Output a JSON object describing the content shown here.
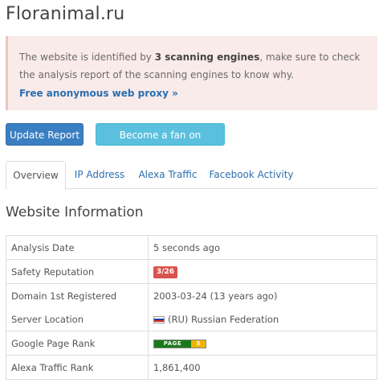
{
  "site_title": "Floranimal.ru",
  "alert": {
    "text_before": "The website is identified by ",
    "text_bold": "3 scanning engines",
    "text_after": ", make sure to check the analysis report of the scanning engines to know why.",
    "proxy_link": "Free anonymous web proxy »"
  },
  "buttons": {
    "update_report": "Update Report",
    "facebook_fan": "Become a fan on Facebook"
  },
  "tabs": [
    {
      "label": "Overview",
      "active": true
    },
    {
      "label": "IP Address",
      "active": false
    },
    {
      "label": "Alexa Traffic",
      "active": false
    },
    {
      "label": "Facebook Activity",
      "active": false
    }
  ],
  "section_title": "Website Information",
  "info": {
    "analysis_date_label": "Analysis Date",
    "analysis_date_value": "5 seconds ago",
    "safety_label": "Safety Reputation",
    "safety_value": "3/26",
    "domain_label": "Domain 1st Registered",
    "domain_value": "2003-03-24 (13 years ago)",
    "server_label": "Server Location",
    "server_value": "(RU) Russian Federation",
    "pagerank_label": "Google Page Rank",
    "pagerank_text": "PAGE RANK",
    "pagerank_value": "5",
    "alexa_label": "Alexa Traffic Rank",
    "alexa_value": "1,861,400"
  },
  "colors": {
    "alert_bg": "#f9ebea",
    "link": "#2a6fb0",
    "primary": "#3a7fc1",
    "info": "#5bc0de",
    "danger": "#d9534f"
  }
}
